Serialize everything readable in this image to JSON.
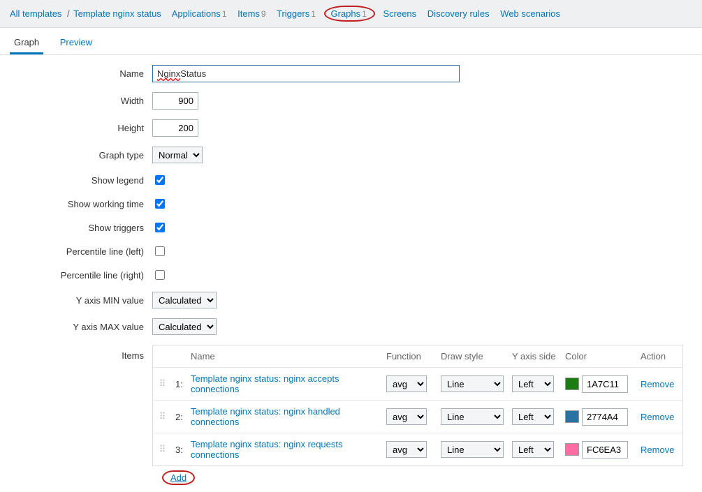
{
  "breadcrumb": {
    "all_templates": "All templates",
    "template_name": "Template nginx status",
    "applications": {
      "label": "Applications",
      "count": 1
    },
    "items": {
      "label": "Items",
      "count": 9
    },
    "triggers": {
      "label": "Triggers",
      "count": 1
    },
    "graphs": {
      "label": "Graphs",
      "count": 1
    },
    "screens": {
      "label": "Screens"
    },
    "discovery": {
      "label": "Discovery rules"
    },
    "web": {
      "label": "Web scenarios"
    }
  },
  "tabs": {
    "graph": "Graph",
    "preview": "Preview"
  },
  "form": {
    "name_label": "Name",
    "name_value_spell": "Nginx",
    "name_value_rest": " Status",
    "width_label": "Width",
    "width_value": "900",
    "height_label": "Height",
    "height_value": "200",
    "graph_type_label": "Graph type",
    "graph_type_value": "Normal",
    "show_legend_label": "Show legend",
    "show_working_time_label": "Show working time",
    "show_triggers_label": "Show triggers",
    "percentile_left_label": "Percentile line (left)",
    "percentile_right_label": "Percentile line (right)",
    "ymin_label": "Y axis MIN value",
    "ymin_value": "Calculated",
    "ymax_label": "Y axis MAX value",
    "ymax_value": "Calculated",
    "items_label": "Items"
  },
  "items_header": {
    "name": "Name",
    "function": "Function",
    "draw": "Draw style",
    "yaxis": "Y axis side",
    "color": "Color",
    "action": "Action"
  },
  "items": [
    {
      "idx": "1:",
      "name": "Template nginx status: nginx accepts connections",
      "func": "avg",
      "draw": "Line",
      "yaxis": "Left",
      "color": "1A7C11",
      "action": "Remove"
    },
    {
      "idx": "2:",
      "name": "Template nginx status: nginx handled connections",
      "func": "avg",
      "draw": "Line",
      "yaxis": "Left",
      "color": "2774A4",
      "action": "Remove"
    },
    {
      "idx": "3:",
      "name": "Template nginx status: nginx requests connections",
      "func": "avg",
      "draw": "Line",
      "yaxis": "Left",
      "color": "FC6EA3",
      "action": "Remove"
    }
  ],
  "add_label": "Add",
  "colors": {
    "1A7C11": "#1A7C11",
    "2774A4": "#2774A4",
    "FC6EA3": "#FC6EA3"
  }
}
